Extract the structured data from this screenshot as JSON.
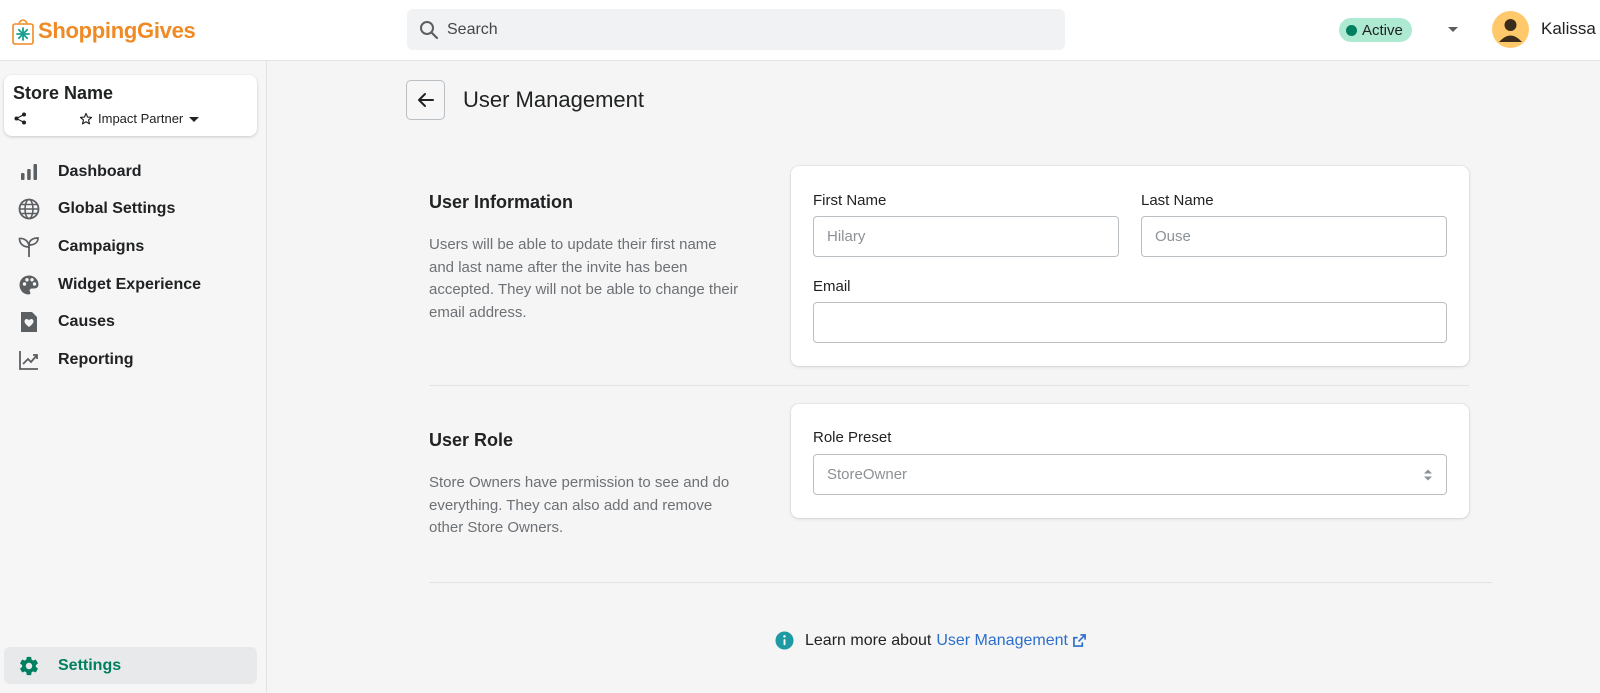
{
  "header": {
    "brand": "ShoppingGives",
    "search_placeholder": "Search",
    "status_label": "Active",
    "user_name": "Kalissa",
    "colors": {
      "brand": "#f08a24",
      "status_bg": "#aee9d1",
      "status_dot": "#007f5f"
    }
  },
  "sidebar": {
    "store_name": "Store Name",
    "partner_label": "Impact Partner",
    "items": [
      {
        "label": "Dashboard",
        "icon": "bar-chart-icon"
      },
      {
        "label": "Global Settings",
        "icon": "globe-icon"
      },
      {
        "label": "Campaigns",
        "icon": "sprout-icon"
      },
      {
        "label": "Widget Experience",
        "icon": "palette-icon"
      },
      {
        "label": "Causes",
        "icon": "heart-document-icon"
      },
      {
        "label": "Reporting",
        "icon": "trend-chart-icon"
      }
    ],
    "settings_label": "Settings"
  },
  "page": {
    "title": "User Management"
  },
  "user_info": {
    "title": "User Information",
    "description": "Users will be able to update their first name and last name after the invite has been accepted. They will not be able to change their email address.",
    "first_name_label": "First Name",
    "first_name_value": "Hilary",
    "last_name_label": "Last Name",
    "last_name_value": "Ouse",
    "email_label": "Email",
    "email_value": ""
  },
  "user_role": {
    "title": "User Role",
    "description": "Store Owners have permission to see and do everything. They can also add and remove other Store Owners.",
    "role_label": "Role Preset",
    "role_value": "StoreOwner"
  },
  "footer": {
    "learn_prefix": "Learn more about",
    "learn_link": "User Management"
  }
}
